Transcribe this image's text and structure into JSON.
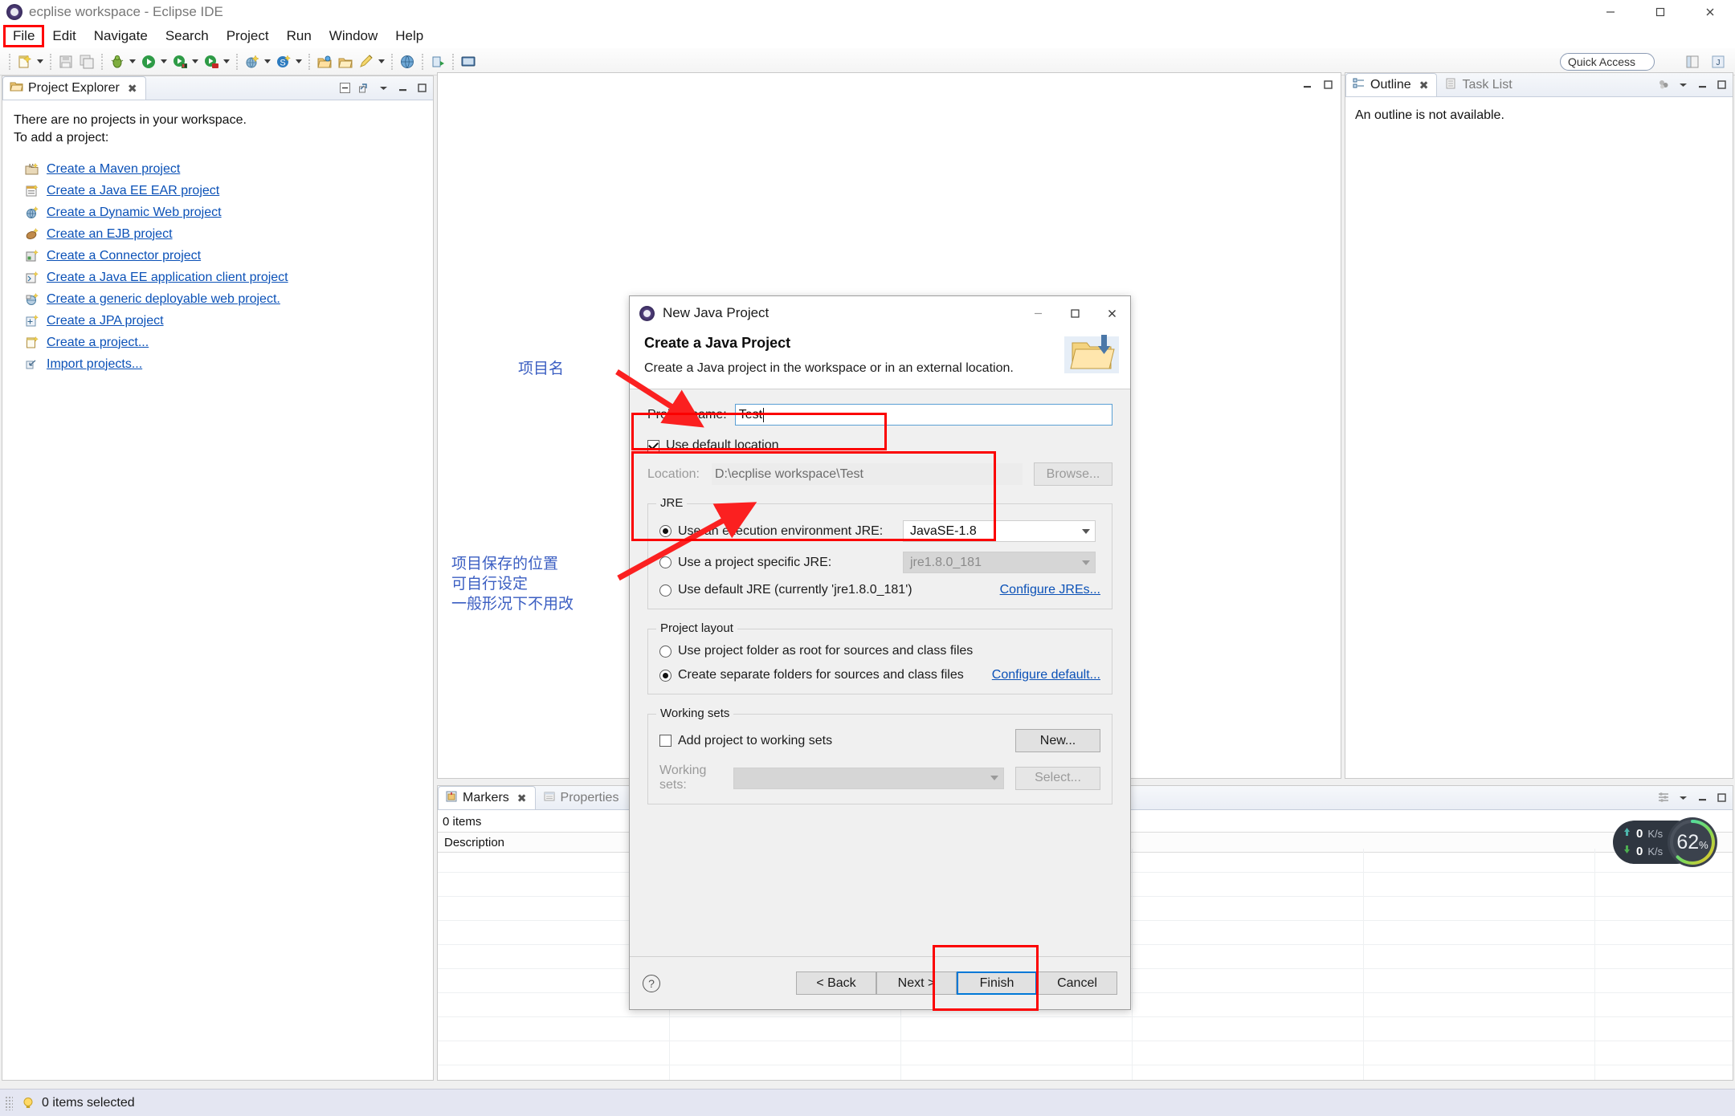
{
  "window": {
    "title": "ecplise workspace - Eclipse IDE",
    "minimize": "─",
    "maximize": "☐",
    "close": "✕"
  },
  "menubar": {
    "items": [
      {
        "label": "File",
        "highlighted": true
      },
      {
        "label": "Edit"
      },
      {
        "label": "Navigate"
      },
      {
        "label": "Search"
      },
      {
        "label": "Project"
      },
      {
        "label": "Run"
      },
      {
        "label": "Window"
      },
      {
        "label": "Help"
      }
    ]
  },
  "toolbar": {
    "quick_access": "Quick Access"
  },
  "project_explorer": {
    "tab_label": "Project Explorer",
    "tab_close": "✖",
    "empty_line1": "There are no projects in your workspace.",
    "empty_line2": "To add a project:",
    "links": [
      {
        "label": "Create a Maven project",
        "icon": "maven-project-icon"
      },
      {
        "label": "Create a Java EE EAR project",
        "icon": "ear-project-icon"
      },
      {
        "label": "Create a Dynamic Web project",
        "icon": "dynamic-web-project-icon"
      },
      {
        "label": "Create an EJB project",
        "icon": "ejb-project-icon"
      },
      {
        "label": "Create a Connector project",
        "icon": "connector-project-icon"
      },
      {
        "label": "Create a Java EE application client project",
        "icon": "app-client-project-icon"
      },
      {
        "label": "Create a generic deployable web project.",
        "icon": "generic-web-project-icon"
      },
      {
        "label": "Create a JPA project",
        "icon": "jpa-project-icon"
      },
      {
        "label": "Create a project...",
        "icon": "new-project-icon"
      },
      {
        "label": "Import projects...",
        "icon": "import-icon"
      }
    ]
  },
  "outline": {
    "tab_label": "Outline",
    "tab_close": "✖",
    "tasklist_tab": "Task List",
    "empty_message": "An outline is not available."
  },
  "markers": {
    "tab_label": "Markers",
    "tab_close": "✖",
    "properties_tab": "Properties",
    "item_count": "0 items",
    "column_description": "Description"
  },
  "statusbar": {
    "message": "0 items selected"
  },
  "dialog": {
    "window_title": "New Java Project",
    "minimize": "─",
    "maximize": "☐",
    "close": "✕",
    "heading": "Create a Java Project",
    "subheading": "Create a Java project in the workspace or in an external location.",
    "project_name_label": "Project name:",
    "project_name_value": "Test",
    "use_default_location_label": "Use default location",
    "use_default_location_checked": true,
    "location_label": "Location:",
    "location_value": "D:\\ecplise workspace\\Test",
    "browse_button": "Browse...",
    "jre": {
      "group_title": "JRE",
      "option_exec_env": "Use an execution environment JRE:",
      "exec_env_value": "JavaSE-1.8",
      "option_project_specific": "Use a project specific JRE:",
      "project_specific_value": "jre1.8.0_181",
      "option_default": "Use default JRE (currently 'jre1.8.0_181')",
      "configure_link": "Configure JREs...",
      "selected": "exec_env"
    },
    "layout": {
      "group_title": "Project layout",
      "option_project_folder": "Use project folder as root for sources and class files",
      "option_separate_folders": "Create separate folders for sources and class files",
      "configure_link": "Configure default...",
      "selected": "separate_folders"
    },
    "working_sets": {
      "group_title": "Working sets",
      "add_checkbox_label": "Add project to working sets",
      "add_checked": false,
      "new_button": "New...",
      "working_sets_label": "Working sets:",
      "working_sets_value": "",
      "select_button": "Select..."
    },
    "footer": {
      "help": "?",
      "back": "< Back",
      "next": "Next >",
      "finish": "Finish",
      "cancel": "Cancel"
    }
  },
  "annotations": {
    "project_name_note": "项目名",
    "location_note": "项目保存的位置\n可自行设定\n一般形况下不用改"
  },
  "net_widget": {
    "upload_value": "0",
    "upload_unit": "K/s",
    "download_value": "0",
    "download_unit": "K/s",
    "percent": "62",
    "percent_unit": "%"
  },
  "colors": {
    "annotation_red": "#fb0000",
    "annotation_blue": "#3b5ec2",
    "link_blue": "#0b51b7",
    "focus_blue": "#0078d7"
  }
}
